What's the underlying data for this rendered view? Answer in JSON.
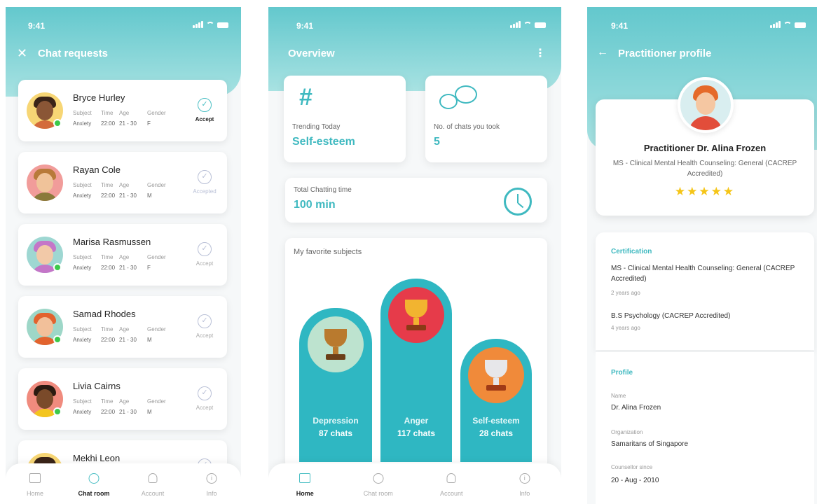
{
  "status_time": "9:41",
  "screen1": {
    "title": "Chat requests",
    "meta_headers": [
      "Subject",
      "Time",
      "Age",
      "Gender"
    ],
    "requests": [
      {
        "name": "Bryce Hurley",
        "subject": "Anxiety",
        "time": "22:00",
        "age": "21 - 30",
        "gender": "F",
        "action": "Accept"
      },
      {
        "name": "Rayan Cole",
        "subject": "Anxiety",
        "time": "22:00",
        "age": "21 - 30",
        "gender": "M",
        "action": "Accepted"
      },
      {
        "name": "Marisa Rasmussen",
        "subject": "Anxiety",
        "time": "22:00",
        "age": "21 - 30",
        "gender": "F",
        "action": "Accept"
      },
      {
        "name": "Samad Rhodes",
        "subject": "Anxiety",
        "time": "22:00",
        "age": "21 - 30",
        "gender": "M",
        "action": "Accept"
      },
      {
        "name": "Livia Cairns",
        "subject": "Anxiety",
        "time": "22:00",
        "age": "21 - 30",
        "gender": "M",
        "action": "Accept"
      },
      {
        "name": "Mekhi Leon"
      }
    ],
    "tabs": [
      "Home",
      "Chat room",
      "Account",
      "Info"
    ]
  },
  "screen2": {
    "title": "Overview",
    "trending_label": "Trending Today",
    "trending_value": "Self-esteem",
    "chats_label": "No. of chats you took",
    "chats_value": "5",
    "time_label": "Total Chatting time",
    "time_value": "100 min",
    "fav_title": "My favorite subjects",
    "subjects": [
      {
        "name": "Depression",
        "count": "87 chats"
      },
      {
        "name": "Anger",
        "count": "117 chats"
      },
      {
        "name": "Self-esteem",
        "count": "28 chats"
      }
    ],
    "tabs": [
      "Home",
      "Chat room",
      "Account",
      "Info"
    ]
  },
  "screen3": {
    "title": "Practitioner profile",
    "name": "Practitioner Dr. Alina Frozen",
    "degree": "MS - Clinical Mental Health Counseling: General (CACREP Accredited)",
    "stars": "★★★★★",
    "cert_title": "Certification",
    "certs": [
      {
        "text": "MS - Clinical Mental Health Counseling: General (CACREP Accredited)",
        "when": "2 years ago"
      },
      {
        "text": "B.S Psychology (CACREP Accredited)",
        "when": "4 years ago"
      }
    ],
    "profile_title": "Profile",
    "name_label": "Name",
    "name_value": "Dr. Alina Frozen",
    "org_label": "Organization",
    "org_value": "Samaritans of Singapore",
    "since_label": "Counsellor since",
    "since_value": "20 - Aug - 2010"
  },
  "colors": {
    "accent": "#3fb9c0",
    "header_top": "#63c8cd",
    "online": "#3cc94a",
    "star": "#f5c518"
  }
}
